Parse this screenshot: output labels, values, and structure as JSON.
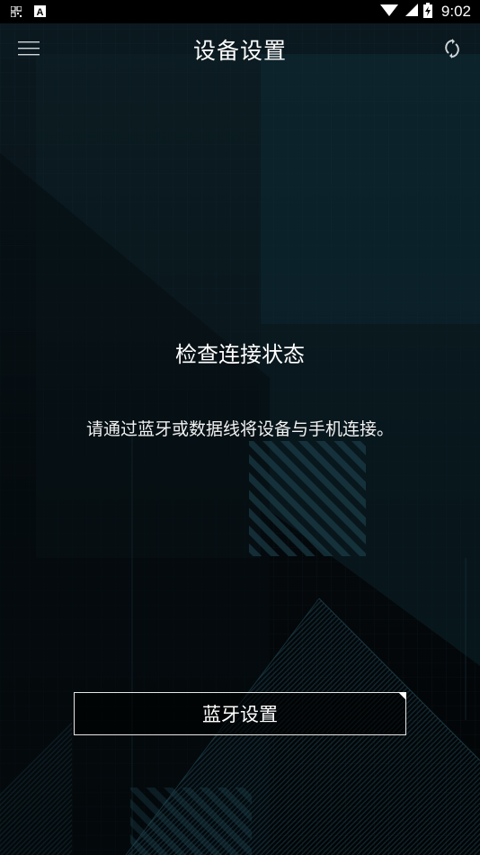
{
  "status_bar": {
    "time": "9:02",
    "left_icons": [
      "qr-icon",
      "a-badge-icon"
    ],
    "right_icons": [
      "wifi-icon",
      "cell-signal-icon",
      "battery-charging-icon"
    ]
  },
  "app_bar": {
    "title": "设备设置",
    "menu_icon": "hamburger-menu-icon",
    "action_icon": "sync-icon"
  },
  "content": {
    "heading": "检查连接状态",
    "description": "请通过蓝牙或数据线将设备与手机连接。"
  },
  "bluetooth_button": {
    "label": "蓝牙设置"
  },
  "colors": {
    "background_top": "#0b1a20",
    "background_bottom": "#020405",
    "text": "#ffffff",
    "button_border": "#e6e6e6"
  }
}
